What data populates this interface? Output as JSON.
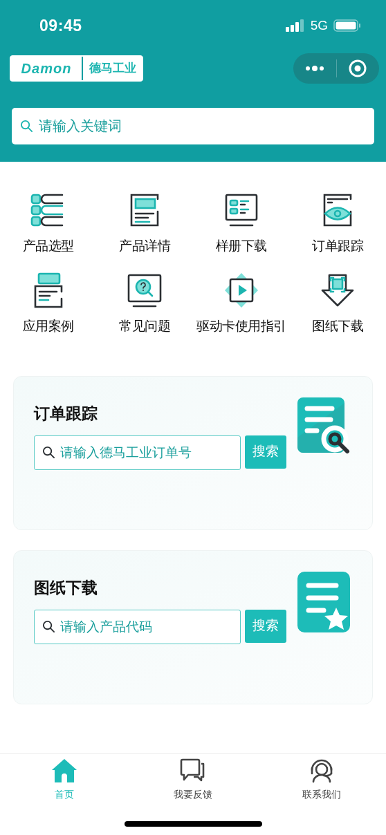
{
  "status_bar": {
    "time": "09:45",
    "network": "5G"
  },
  "header": {
    "logo": {
      "brand": "Damon",
      "name": "德马工业"
    },
    "search": {
      "placeholder": "请输入关键词"
    }
  },
  "shortcuts": [
    {
      "label": "产品选型",
      "kind": "list"
    },
    {
      "label": "产品详情",
      "kind": "detail"
    },
    {
      "label": "样册下载",
      "kind": "catalog"
    },
    {
      "label": "订单跟踪",
      "kind": "eye"
    },
    {
      "label": "应用案例",
      "kind": "case"
    },
    {
      "label": "常见问题",
      "kind": "faq"
    },
    {
      "label": "驱动卡使用指引",
      "kind": "video"
    },
    {
      "label": "图纸下载",
      "kind": "download"
    }
  ],
  "cards": [
    {
      "title": "订单跟踪",
      "placeholder": "请输入德马工业订单号",
      "button": "搜索",
      "kind": "order"
    },
    {
      "title": "图纸下载",
      "placeholder": "请输入产品代码",
      "button": "搜索",
      "kind": "drawing"
    }
  ],
  "tab_bar": [
    {
      "label": "首页",
      "selected": true,
      "kind": "home"
    },
    {
      "label": "我要反馈",
      "selected": false,
      "kind": "chat"
    },
    {
      "label": "联系我们",
      "selected": false,
      "kind": "support"
    }
  ]
}
